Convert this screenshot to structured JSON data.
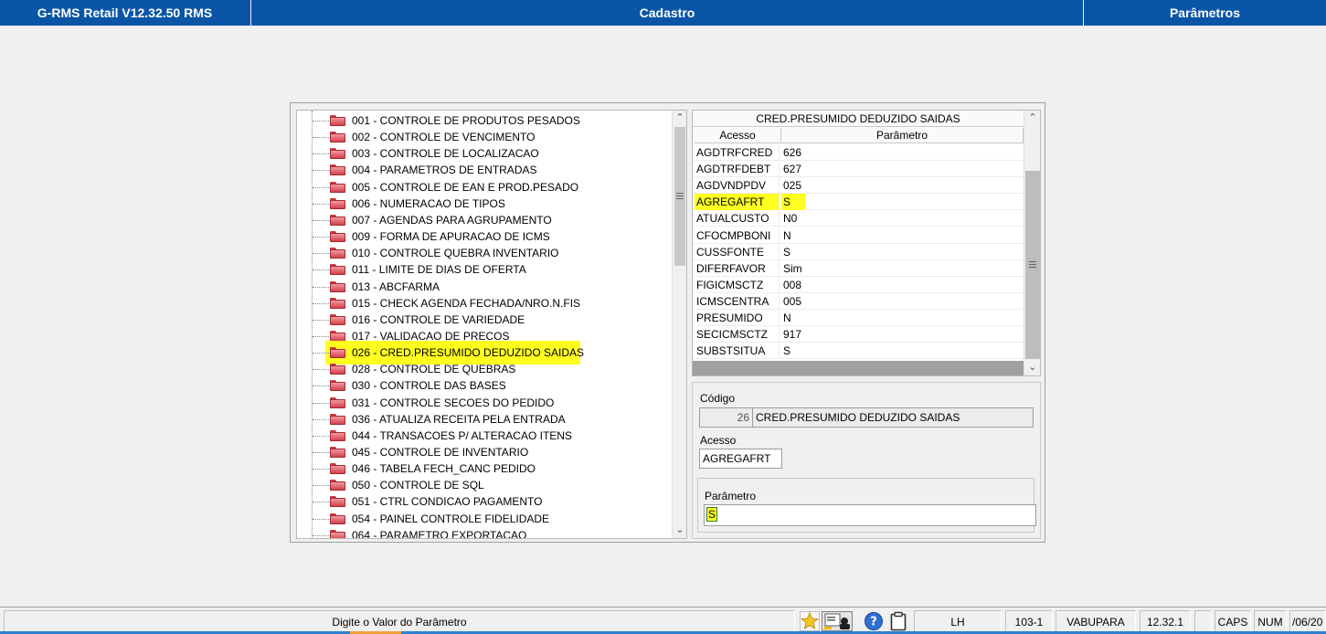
{
  "titlebar": {
    "app": "G-RMS Retail V12.32.50 RMS",
    "module": "Cadastro",
    "section": "Parâmetros"
  },
  "tree": {
    "items": [
      {
        "label": "001 - CONTROLE DE PRODUTOS PESADOS"
      },
      {
        "label": "002 - CONTROLE DE VENCIMENTO"
      },
      {
        "label": "003 - CONTROLE DE LOCALIZACAO"
      },
      {
        "label": "004 - PARAMETROS DE ENTRADAS"
      },
      {
        "label": "005 - CONTROLE DE EAN E PROD.PESADO"
      },
      {
        "label": "006 - NUMERACAO DE TIPOS"
      },
      {
        "label": "007 - AGENDAS PARA AGRUPAMENTO"
      },
      {
        "label": "009 - FORMA DE APURACAO DE ICMS"
      },
      {
        "label": "010 - CONTROLE QUEBRA INVENTARIO"
      },
      {
        "label": "011 - LIMITE DE DIAS DE OFERTA"
      },
      {
        "label": "013 - ABCFARMA"
      },
      {
        "label": "015 - CHECK AGENDA FECHADA/NRO.N.FIS"
      },
      {
        "label": "016 - CONTROLE DE VARIEDADE"
      },
      {
        "label": "017 - VALIDACAO DE PRECOS"
      },
      {
        "label": "026 - CRED.PRESUMIDO DEDUZIDO SAIDAS",
        "selected": true
      },
      {
        "label": "028 - CONTROLE DE QUEBRAS"
      },
      {
        "label": "030 - CONTROLE DAS BASES"
      },
      {
        "label": "031 - CONTROLE SECOES DO PEDIDO"
      },
      {
        "label": "036 - ATUALIZA RECEITA PELA ENTRADA"
      },
      {
        "label": "044 - TRANSACOES P/ ALTERACAO ITENS"
      },
      {
        "label": "045 - CONTROLE DE INVENTARIO"
      },
      {
        "label": "046 - TABELA FECH_CANC PEDIDO"
      },
      {
        "label": "050 - CONTROLE DE SQL"
      },
      {
        "label": "051 - CTRL CONDICAO PAGAMENTO"
      },
      {
        "label": "054 - PAINEL CONTROLE FIDELIDADE"
      },
      {
        "label": "064 - PARAMETRO EXPORTACAO"
      }
    ]
  },
  "grid": {
    "title": "CRED.PRESUMIDO DEDUZIDO SAIDAS",
    "columns": [
      "Acesso",
      "Parâmetro"
    ],
    "rows": [
      {
        "acesso": "AGDTRFCRED",
        "parametro": "626"
      },
      {
        "acesso": "AGDTRFDEBT",
        "parametro": "627"
      },
      {
        "acesso": "AGDVNDPDV",
        "parametro": "025"
      },
      {
        "acesso": "AGREGAFRT",
        "parametro": "S",
        "highlight": true
      },
      {
        "acesso": "ATUALCUSTO",
        "parametro": "N0"
      },
      {
        "acesso": "CFOCMPBONI",
        "parametro": "N"
      },
      {
        "acesso": "CUSSFONTE",
        "parametro": "S"
      },
      {
        "acesso": "DIFERFAVOR",
        "parametro": "Sim"
      },
      {
        "acesso": "FIGICMSCTZ",
        "parametro": "008"
      },
      {
        "acesso": "ICMSCENTRA",
        "parametro": "005"
      },
      {
        "acesso": "PRESUMIDO",
        "parametro": "N"
      },
      {
        "acesso": "SECICMSCTZ",
        "parametro": "917"
      },
      {
        "acesso": "SUBSTSITUA",
        "parametro": "S"
      }
    ]
  },
  "detail": {
    "codigo_label": "Código",
    "codigo_value": "26",
    "codigo_desc": "CRED.PRESUMIDO DEDUZIDO SAIDAS",
    "acesso_label": "Acesso",
    "acesso_value": "AGREGAFRT",
    "parametro_label": "Parâmetro",
    "parametro_value": "S"
  },
  "statusbar": {
    "message": "Digite o Valor do Parâmetro",
    "user": "LH",
    "code": "103-1",
    "store": "VABUPARA",
    "version": "12.32.1",
    "caps": "CAPS",
    "num": "NUM",
    "date": "/06/20"
  },
  "colors": {
    "titlebar": "#0a55a6",
    "highlight": "#ffff1f",
    "folder": "#d2414b"
  }
}
